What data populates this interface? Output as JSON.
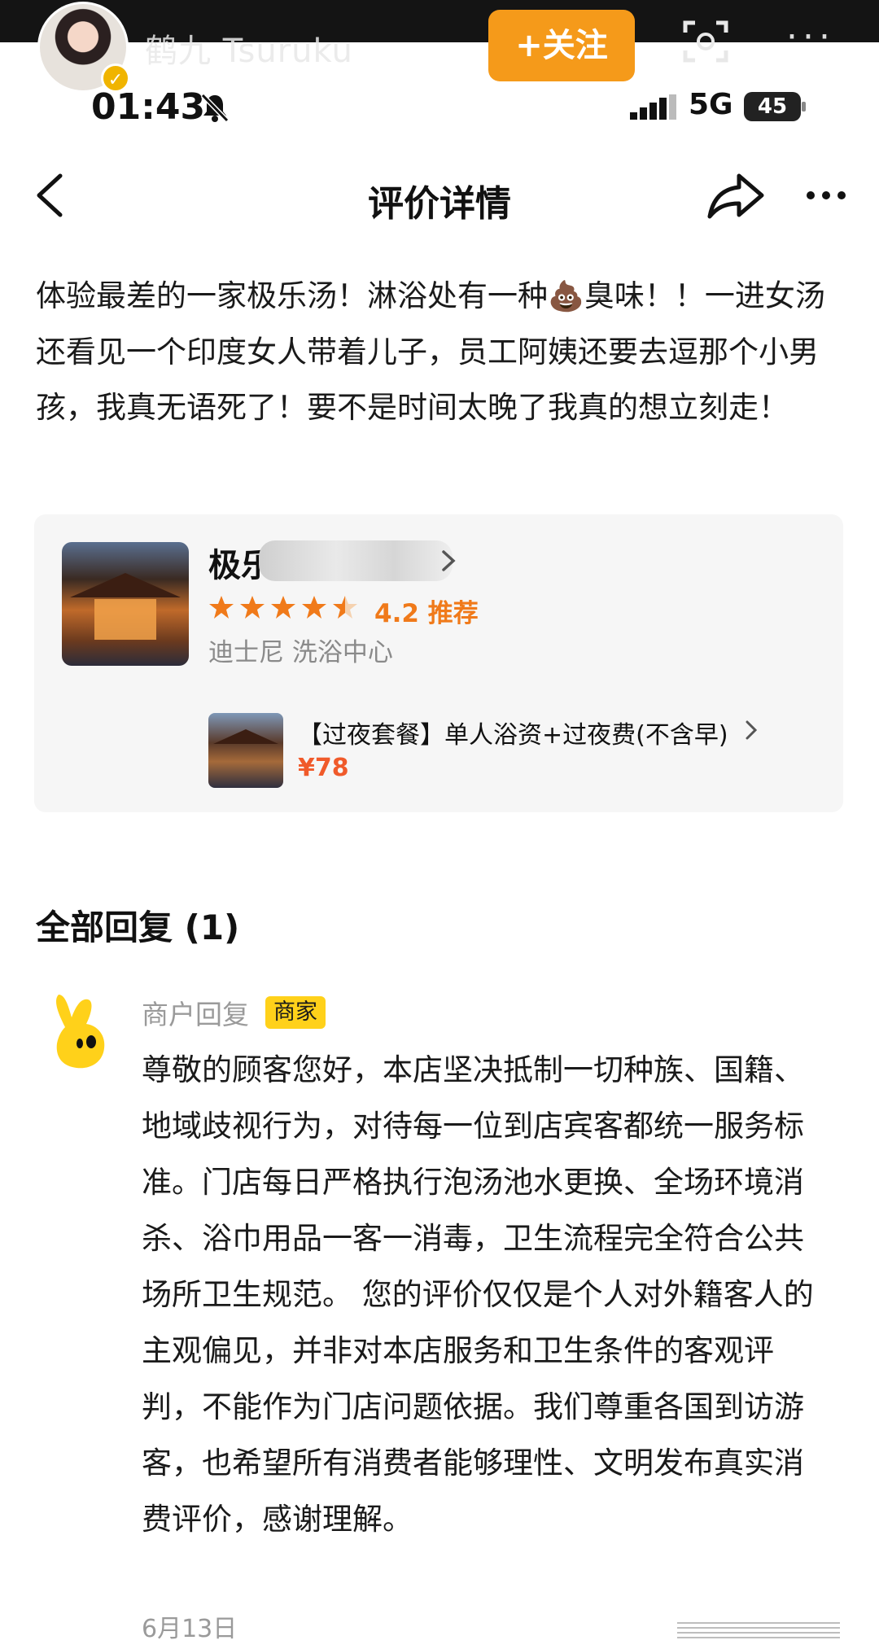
{
  "overlay": {
    "account_name": "鹤九 Tsuruku",
    "follow_label": "+关注",
    "more_label": "···"
  },
  "status_bar": {
    "time": "01:43",
    "network": "5G",
    "battery": "45"
  },
  "nav": {
    "title": "评价详情"
  },
  "review": {
    "text_before_emoji": "体验最差的一家极乐汤！淋浴处有一种",
    "emoji": "💩",
    "text_after_emoji": "臭味！！一进女汤还看见一个印度女人带着儿子，员工阿姨还要去逗那个小男孩，我真无语死了！要不是时间太晚了我真的想立刻走！"
  },
  "shop": {
    "name_visible": "极乐",
    "rating": 4.2,
    "rating_label": "4.2 推荐",
    "category": "迪士尼 洗浴中心",
    "package_title": "【过夜套餐】单人浴资+过夜费(不含早)",
    "package_price": "¥78",
    "colors": {
      "star": "#f07a1a",
      "price": "#f05a2a"
    }
  },
  "replies": {
    "heading": "全部回复 (1)",
    "items": [
      {
        "author": "商户回复",
        "badge": "商家",
        "body": "尊敬的顾客您好，本店坚决抵制一切种族、国籍、地域歧视行为，对待每一位到店宾客都统一服务标准。门店每日严格执行泡汤池水更换、全场环境消杀、浴巾用品一客一消毒，卫生流程完全符合公共场所卫生规范。 您的评价仅仅是个人对外籍客人的主观偏见，并非对本店服务和卫生条件的客观评判，不能作为门店问题依据。我们尊重各国到访游客，也希望所有消费者能够理性、文明发布真实消费评价，感谢理解。",
        "date": "6月13日"
      }
    ]
  },
  "colors": {
    "follow": "#f59a1a",
    "badge": "#ffd11a"
  }
}
